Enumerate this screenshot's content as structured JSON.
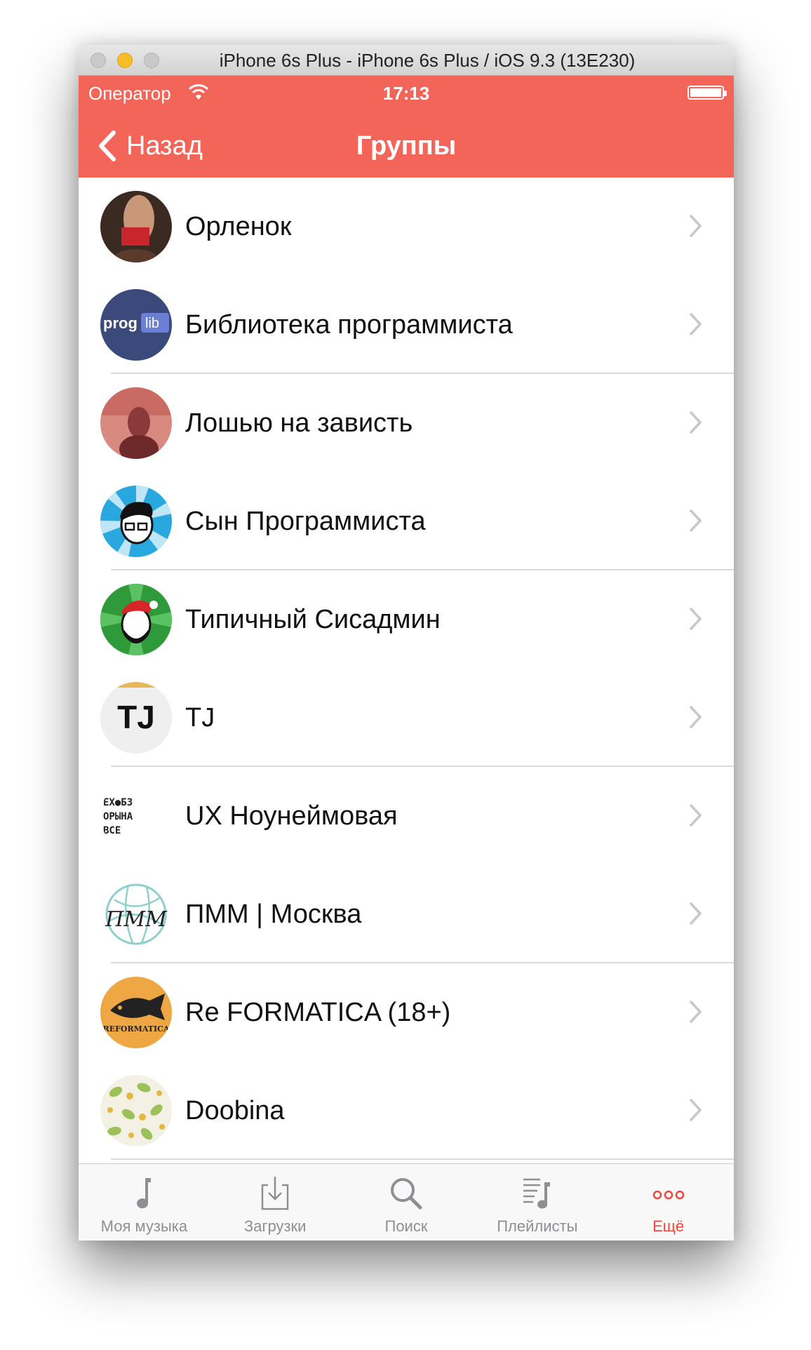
{
  "window": {
    "title": "iPhone 6s Plus - iPhone 6s Plus / iOS 9.3 (13E230)"
  },
  "status_bar": {
    "carrier": "Оператор",
    "time": "17:13"
  },
  "nav": {
    "back_label": "Назад",
    "title": "Группы"
  },
  "colors": {
    "accent": "#f36558",
    "tab_active": "#f0473c",
    "tab_inactive": "#8e8e93"
  },
  "groups": [
    {
      "name": "Орленок",
      "avatar": "photo-avatar"
    },
    {
      "name": "Библиотека программиста",
      "avatar": "proglib-logo"
    },
    {
      "name": "Лошью на зависть",
      "avatar": "photo-avatar"
    },
    {
      "name": "Сын Программиста",
      "avatar": "cartoon-face-avatar"
    },
    {
      "name": "Типичный Сисадмин",
      "avatar": "santa-face-avatar"
    },
    {
      "name": "TJ",
      "avatar": "tj-logo"
    },
    {
      "name": "UX Ноунеймовая",
      "avatar": "letters-logo"
    },
    {
      "name": "ПММ | Москва",
      "avatar": "pmm-logo"
    },
    {
      "name": "Re FORMATICA (18+)",
      "avatar": "fish-logo"
    },
    {
      "name": "Doobina",
      "avatar": "leaves-pattern-avatar"
    }
  ],
  "avatar_text": {
    "proglib_left": "prog",
    "proglib_right": "lib",
    "tj": "TJ",
    "ux_row1": "ЕХ●БЗ",
    "ux_row2": "ОРЫНА",
    "ux_row3": "ВСЕ",
    "pmm": "ПММ",
    "reformatica": "REFORMATICA"
  },
  "tabbar": {
    "tabs": [
      {
        "label": "Моя музыка",
        "icon": "music-note-icon",
        "active": false
      },
      {
        "label": "Загрузки",
        "icon": "download-tray-icon",
        "active": false
      },
      {
        "label": "Поиск",
        "icon": "search-icon",
        "active": false
      },
      {
        "label": "Плейлисты",
        "icon": "playlist-icon",
        "active": false
      },
      {
        "label": "Ещё",
        "icon": "more-dots-icon",
        "active": true
      }
    ]
  }
}
